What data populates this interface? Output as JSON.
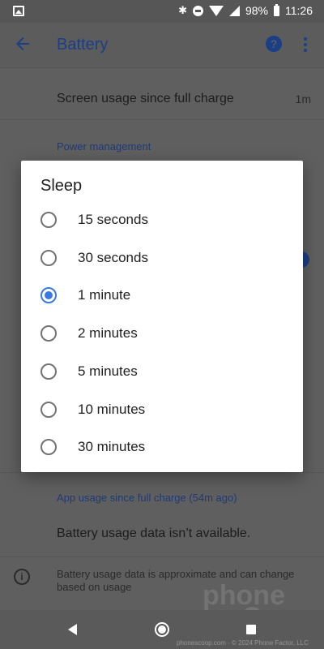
{
  "status_bar": {
    "battery_percent": "98%",
    "time": "11:26",
    "icons": [
      "image-icon",
      "bluetooth-icon",
      "do-not-disturb-icon",
      "wifi-icon",
      "cellular-icon",
      "battery-icon"
    ]
  },
  "app_bar": {
    "title": "Battery",
    "icons": [
      "back-arrow-icon",
      "help-icon",
      "more-vert-icon"
    ]
  },
  "background": {
    "screen_usage_label": "Screen usage since full charge",
    "screen_usage_value": "1m",
    "power_management_header": "Power management",
    "app_usage_header": "App usage since full charge (54m ago)",
    "battery_unavailable": "Battery usage data isn’t available.",
    "info_text": "Battery usage data is approximate and can change based on usage"
  },
  "dialog": {
    "title": "Sleep",
    "options": [
      {
        "label": "15 seconds",
        "selected": false
      },
      {
        "label": "30 seconds",
        "selected": false
      },
      {
        "label": "1 minute",
        "selected": true
      },
      {
        "label": "2 minutes",
        "selected": false
      },
      {
        "label": "5 minutes",
        "selected": false
      },
      {
        "label": "10 minutes",
        "selected": false
      },
      {
        "label": "30 minutes",
        "selected": false
      }
    ]
  },
  "watermark": {
    "line1": "phone",
    "line2": "Scoop",
    "footer": "phonescoop.com · © 2024 Phone Factor, LLC"
  },
  "colors": {
    "accent": "#3a7ae2",
    "scrim": "#5f5f5f",
    "dialog_bg": "#ffffff"
  }
}
